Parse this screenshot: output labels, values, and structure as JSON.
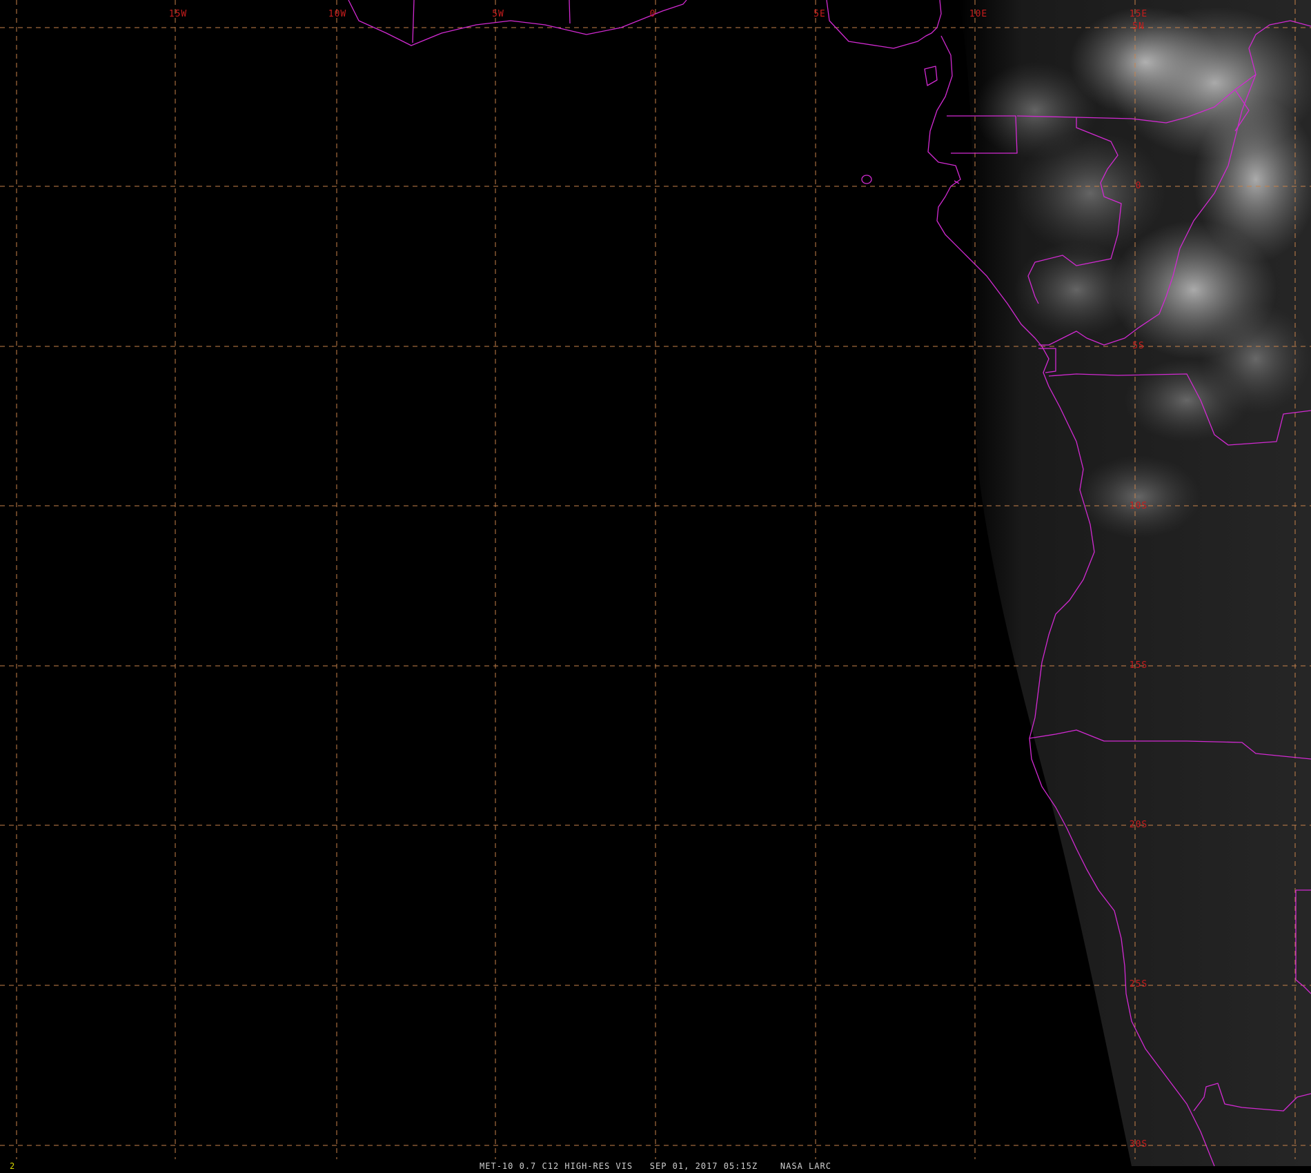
{
  "image_meta": {
    "satellite": "MET-10",
    "channel": "0.7 C12 HIGH-RES VIS",
    "date": "SEP 01, 2017",
    "time": "05:15Z",
    "source": "NASA LARC",
    "frame_number": "2"
  },
  "colors": {
    "background": "#000000",
    "coastline": "#d22ad2",
    "gridline": "#c8824a",
    "grid_label": "#c81c1c",
    "frame_label": "#d8d800",
    "caption": "#d0d0d0"
  },
  "grid": {
    "lon_labels": [
      "15W",
      "10W",
      "5W",
      "0",
      "5E",
      "10E",
      "15E"
    ],
    "lat_labels": [
      "5N",
      "0",
      "5S",
      "10S",
      "15S",
      "20S",
      "25S",
      "30S"
    ]
  },
  "map": {
    "region": "West Africa / Gulf of Guinea",
    "land_overlay": "borders-and-coastlines"
  }
}
